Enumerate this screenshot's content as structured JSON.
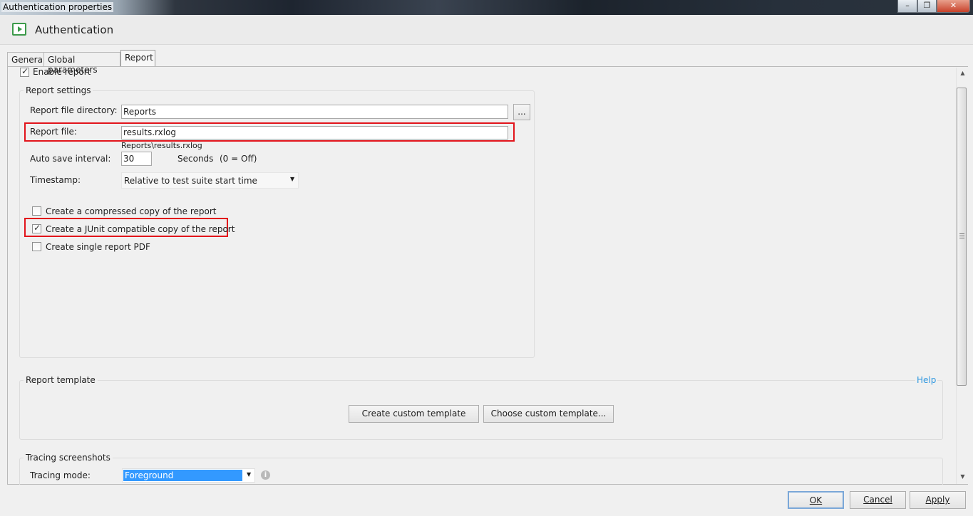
{
  "window": {
    "title": "Authentication properties",
    "minimize_glyph": "–",
    "maximize_glyph": "❐",
    "close_glyph": "✕"
  },
  "header": {
    "title": "Authentication"
  },
  "tabs": [
    {
      "label": "General"
    },
    {
      "label": "Global parameters"
    },
    {
      "label": "Report",
      "active": true
    }
  ],
  "report_tab": {
    "enable_report": {
      "label": "Enable report",
      "checked": true
    },
    "report_settings": {
      "title": "Report settings",
      "directory": {
        "label": "Report file directory:",
        "value": "Reports",
        "browse_label": "..."
      },
      "file": {
        "label": "Report file:",
        "value": "results.rxlog",
        "hint": "Reports\\results.rxlog"
      },
      "auto_save": {
        "label": "Auto save interval:",
        "value": "30",
        "unit": "Seconds",
        "note": "(0 = Off)"
      },
      "timestamp": {
        "label": "Timestamp:",
        "value": "Relative to test suite start time"
      },
      "options": [
        {
          "label": "Create a compressed copy of the report",
          "checked": false
        },
        {
          "label": "Create a JUnit compatible copy of the report",
          "checked": true
        },
        {
          "label": "Create single report PDF",
          "checked": false
        }
      ]
    },
    "report_template": {
      "title": "Report template",
      "help_label": "Help",
      "create_label": "Create custom template",
      "choose_label": "Choose custom template..."
    },
    "tracing": {
      "title": "Tracing screenshots",
      "mode_label": "Tracing mode:",
      "mode_value": "Foreground"
    }
  },
  "footer": {
    "ok": "OK",
    "cancel": "Cancel",
    "apply": "Apply"
  },
  "colors": {
    "highlight": "#e2141b",
    "selection": "#3399ff",
    "link": "#3399e0"
  }
}
